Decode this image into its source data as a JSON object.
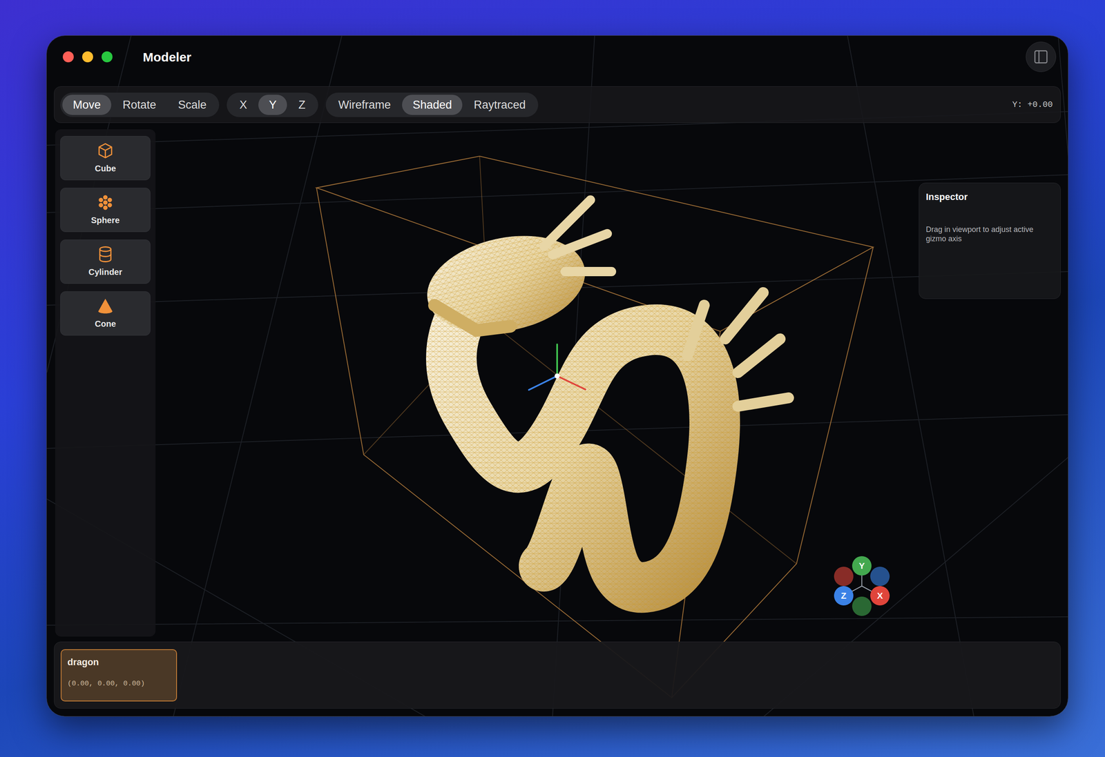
{
  "window": {
    "title": "Modeler"
  },
  "toolbar": {
    "transform_modes": [
      {
        "label": "Move",
        "selected": true
      },
      {
        "label": "Rotate",
        "selected": false
      },
      {
        "label": "Scale",
        "selected": false
      }
    ],
    "axes": [
      {
        "label": "X",
        "selected": false
      },
      {
        "label": "Y",
        "selected": true
      },
      {
        "label": "Z",
        "selected": false
      }
    ],
    "render_modes": [
      {
        "label": "Wireframe",
        "selected": false
      },
      {
        "label": "Shaded",
        "selected": true
      },
      {
        "label": "Raytraced",
        "selected": false
      }
    ],
    "readout": "Y: +0.00"
  },
  "palette": [
    {
      "label": "Cube",
      "kind": "cube"
    },
    {
      "label": "Sphere",
      "kind": "sphere"
    },
    {
      "label": "Cylinder",
      "kind": "cylinder"
    },
    {
      "label": "Cone",
      "kind": "cone"
    }
  ],
  "inspector": {
    "title": "Inspector",
    "hint": "Drag in viewport to adjust active gizmo axis"
  },
  "orientation_gizmo": [
    {
      "label": "Y",
      "color": "#43a84f"
    },
    {
      "label": "Z",
      "color": "#3b82e6"
    },
    {
      "label": "X",
      "color": "#e0453b"
    }
  ],
  "objects": [
    {
      "name": "dragon",
      "position": "(0.00, 0.00, 0.00)",
      "selected": true
    }
  ]
}
